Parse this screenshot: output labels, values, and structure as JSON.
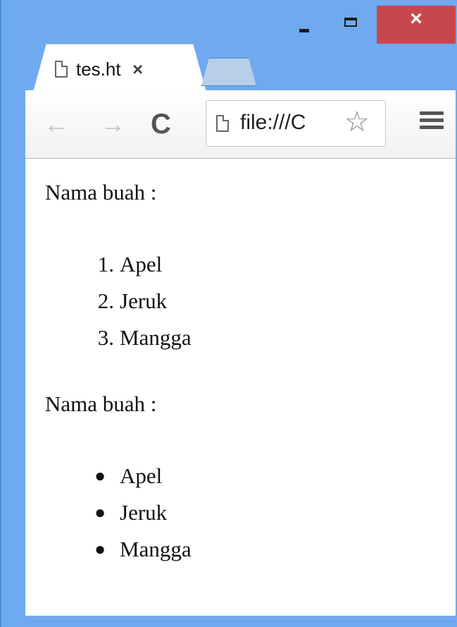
{
  "window": {
    "minimize_label": "minimize",
    "maximize_label": "maximize",
    "close_glyph": "×"
  },
  "tabs": [
    {
      "title": "tes.ht",
      "close_glyph": "×",
      "icon": "page-icon",
      "active": true
    }
  ],
  "toolbar": {
    "back_glyph": "←",
    "forward_glyph": "→",
    "reload_glyph": "C",
    "url": "file:///C",
    "star_glyph": "☆",
    "menu_icon": "hamburger-menu-icon"
  },
  "content": {
    "heading1": "Nama buah :",
    "ordered_list": [
      {
        "marker": "1.",
        "label": "Apel"
      },
      {
        "marker": "2.",
        "label": "Jeruk"
      },
      {
        "marker": "3.",
        "label": "Mangga"
      }
    ],
    "heading2": "Nama buah :",
    "unordered_list": [
      {
        "label": "Apel"
      },
      {
        "label": "Jeruk"
      },
      {
        "label": "Mangga"
      }
    ]
  },
  "colors": {
    "frame": "#6faaf0",
    "close_button": "#c7474d"
  }
}
